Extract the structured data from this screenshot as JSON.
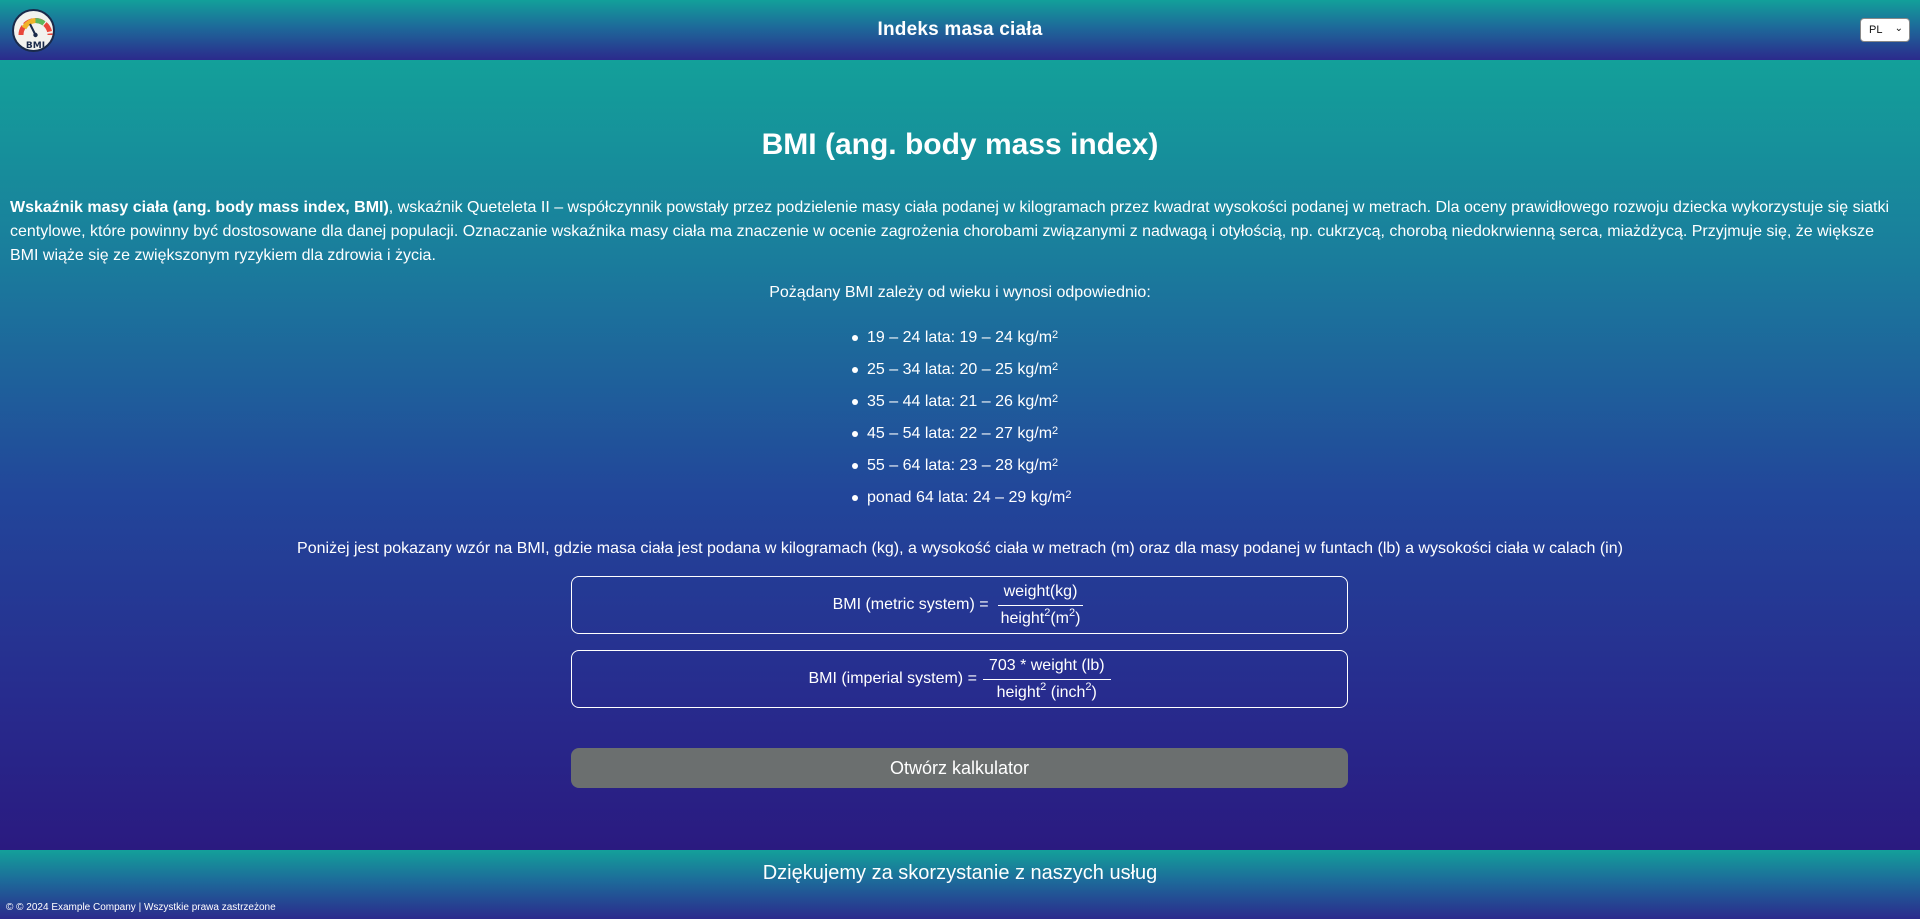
{
  "header": {
    "logo_text": "BMI",
    "title": "Indeks masa ciała",
    "language": "PL"
  },
  "main": {
    "heading": "BMI (ang. body mass index)",
    "intro_bold": "Wskaźnik masy ciała (ang. body mass index, BMI)",
    "intro_rest": ", wskaźnik Queteleta II – współczynnik powstały przez podzielenie masy ciała podanej w kilogramach przez kwadrat wysokości podanej w metrach. Dla oceny prawidłowego rozwoju dziecka wykorzystuje się siatki centylowe, które powinny być dostosowane dla danej populacji. Oznaczanie wskaźnika masy ciała ma znaczenie w ocenie zagrożenia chorobami związanymi z nadwagą i otyłością, np. cukrzycą, chorobą niedokrwienną serca, miażdżycą. Przyjmuje się, że większe BMI wiąże się ze zwiększonym ryzykiem dla zdrowia i życia.",
    "desired_intro": "Pożądany BMI zależy od wieku i wynosi odpowiednio:",
    "ranges": [
      "19 – 24 lata: 19 – 24 kg/m",
      "25 – 34 lata: 20 – 25 kg/m",
      "35 – 44 lata: 21 – 26 kg/m",
      "45 – 54 lata: 22 – 27 kg/m",
      "55 – 64 lata: 23 – 28 kg/m",
      "ponad 64 lata: 24 – 29 kg/m"
    ],
    "range_exponent": "2",
    "formula_note": "Poniżej jest pokazany wzór na BMI, gdzie masa ciała jest podana w kilogramach (kg), a wysokość ciała w metrach (m) oraz dla masy podanej w funtach (lb) a wysokości ciała w calach (in)",
    "metric_formula": {
      "label": "BMI (metric system) =",
      "numerator": "weight(kg)",
      "den_a": "height",
      "den_sup_a": "2",
      "den_b": "(m",
      "den_sup_b": "2",
      "den_c": ")"
    },
    "imperial_formula": {
      "label": "BMI (imperial system) =",
      "numerator": "703 * weight (lb)",
      "den_a": "height",
      "den_sup_a": "2",
      "den_b": " (inch",
      "den_sup_b": "2",
      "den_c": ")"
    },
    "calculator_button": "Otwórz kalkulator"
  },
  "footer": {
    "thanks": "Dziękujemy za skorzystanie z naszych usług",
    "copyright": "© © 2024 Example Company | Wszystkie prawa zastrzeżone"
  }
}
